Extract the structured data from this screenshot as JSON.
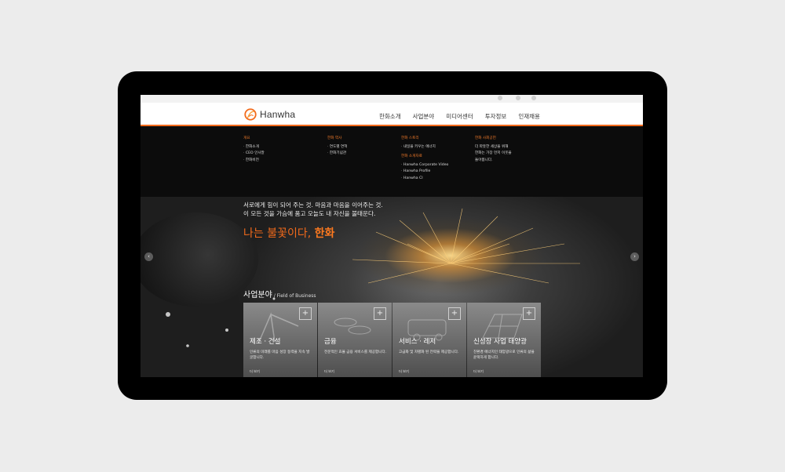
{
  "header": {
    "brand": "Hanwha",
    "nav": [
      "한화소개",
      "사업분야",
      "미디어센터",
      "투자정보",
      "인재채용"
    ]
  },
  "mega_menu": {
    "col1": {
      "head": "개요",
      "items": [
        "한화소개",
        "CEO 인사말",
        "한화비전"
      ]
    },
    "col2": {
      "head": "한화 역사",
      "items": [
        "연도별 연혁",
        "한화기념관"
      ]
    },
    "col3": {
      "head": "한화 스토리",
      "items": [
        "내일을 키우는 에너지"
      ],
      "head2": "한화 소개자료",
      "items2": [
        "Hanwha Corporate Video",
        "Hanwha Profile",
        "Hanwha CI"
      ]
    },
    "col4": {
      "head": "한화 사회공헌",
      "lines": [
        "더 따뜻한 세상을 위해",
        "한화는 가장 먼저 이웃을",
        "돌아봅니다."
      ]
    }
  },
  "hero": {
    "line1": "서로에게 힘이 되어 주는 것. 마음과 마음을 이어주는 것.",
    "line2": "이 모든 것을 가슴에 품고 오늘도 내 자신을 불태운다.",
    "slogan_pre": "나는 불꽃이다,",
    "slogan_brand": "한화",
    "prev": "‹",
    "next": "›"
  },
  "business": {
    "title_ko": "사업분야",
    "title_en": " / Field of Business",
    "cards": [
      {
        "title": "제조 · 건설",
        "desc": "인류의 미래를 마음 성장 동력을 지속 발굴합니다.",
        "more": "더 보기"
      },
      {
        "title": "금융",
        "desc": "전문적인 효율 금융 서비스를 제공합니다.",
        "more": "더 보기"
      },
      {
        "title": "서비스 · 레저",
        "desc": "고급화 및 차별화 된 전략을 제공합니다.",
        "more": "더 보기"
      },
      {
        "title": "신성장 사업 태양광",
        "desc": "친환경 에너지인 태양광으로 인류의 삶을 윤택하게 합니다.",
        "more": "더 보기"
      }
    ]
  },
  "colors": {
    "accent": "#f26a1b",
    "bezel": "#000000",
    "background": "#ececec"
  },
  "icons": [
    "hanwha-logo-icon",
    "plus-icon",
    "chevron-left-icon",
    "chevron-right-icon"
  ]
}
